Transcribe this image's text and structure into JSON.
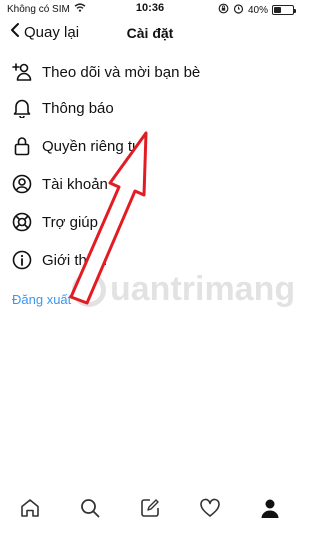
{
  "status_bar": {
    "carrier": "Không có SIM",
    "time": "10:36",
    "battery": "40%",
    "battery_level": 0.4
  },
  "nav": {
    "back_label": "Quay lại",
    "title": "Cài đặt"
  },
  "menu": {
    "items": [
      {
        "label": "Theo dõi và mời bạn bè",
        "icon": "add-person-icon"
      },
      {
        "label": "Thông báo",
        "icon": "bell-icon"
      },
      {
        "label": "Quyền riêng tư",
        "icon": "lock-icon"
      },
      {
        "label": "Tài khoản",
        "icon": "account-icon"
      },
      {
        "label": "Trợ giúp",
        "icon": "lifebuoy-icon"
      },
      {
        "label": "Giới thiệu",
        "icon": "info-icon"
      }
    ],
    "logout_label": "Đăng xuất"
  },
  "watermark": {
    "text": "uantrimang"
  },
  "tab_bar": {
    "tabs": [
      "home-icon",
      "search-icon",
      "new-post-icon",
      "heart-icon",
      "profile-icon"
    ]
  },
  "colors": {
    "link": "#3897f0",
    "arrow": "#e31b23"
  }
}
